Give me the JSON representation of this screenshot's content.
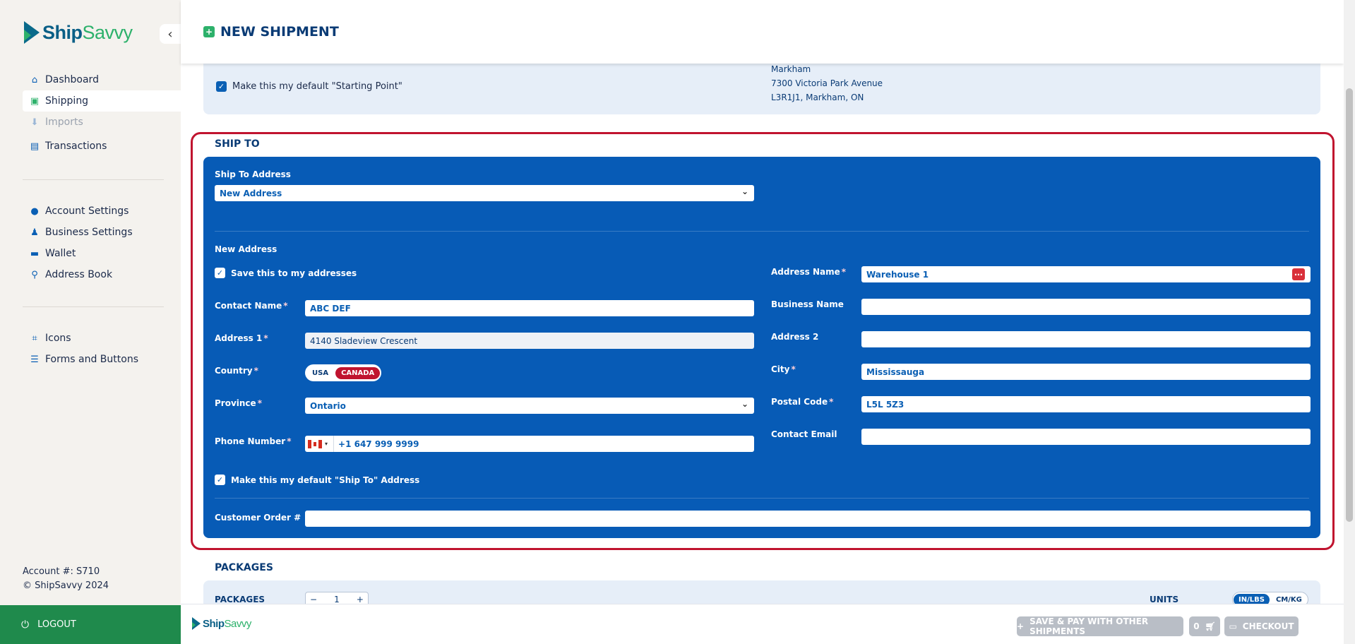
{
  "brand": {
    "name_part1": "Ship",
    "name_part2": "Savvy"
  },
  "sidebar": {
    "collapse_icon": "chevron-left-icon",
    "items": [
      {
        "label": "Dashboard",
        "icon": "home-icon"
      },
      {
        "label": "Shipping",
        "icon": "package-icon",
        "active": true
      },
      {
        "label": "Imports",
        "icon": "import-icon",
        "disabled": true
      },
      {
        "label": "Transactions",
        "icon": "document-icon"
      },
      {
        "label": "Account Settings",
        "icon": "user-circle-icon"
      },
      {
        "label": "Business Settings",
        "icon": "business-user-icon"
      },
      {
        "label": "Wallet",
        "icon": "wallet-icon"
      },
      {
        "label": "Address Book",
        "icon": "map-pin-icon"
      },
      {
        "label": "Icons",
        "icon": "scan-icon"
      },
      {
        "label": "Forms and Buttons",
        "icon": "table-icon"
      }
    ],
    "account_number": "Account #: S710",
    "copyright": "© ShipSavvy 2024",
    "logout": "LOGOUT"
  },
  "header": {
    "title": "NEW SHIPMENT"
  },
  "starting_point": {
    "default_label": "Make this my default \"Starting Point\"",
    "address_lines": [
      "Markham",
      "7300 Victoria Park Avenue",
      "L3R1J1, Markham, ON"
    ]
  },
  "ship_to": {
    "section_title": "SHIP TO",
    "address_select_label": "Ship To Address",
    "address_select_value": "New Address",
    "new_address_heading": "New Address",
    "save_label": "Save this to my addresses",
    "contact_name_label": "Contact Name",
    "contact_name_value": "ABC DEF",
    "address1_label": "Address 1",
    "address1_value": "4140 Sladeview Crescent",
    "country_label": "Country",
    "country_options": [
      "USA",
      "CANADA"
    ],
    "country_selected": "CANADA",
    "province_label": "Province",
    "province_value": "Ontario",
    "phone_label": "Phone Number",
    "phone_value": "+1 647 999 9999",
    "address_name_label": "Address Name",
    "address_name_value": "Warehouse 1",
    "business_name_label": "Business Name",
    "business_name_value": "",
    "address2_label": "Address 2",
    "address2_value": "",
    "city_label": "City",
    "city_value": "Mississauga",
    "postal_label": "Postal Code",
    "postal_value": "L5L 5Z3",
    "email_label": "Contact Email",
    "email_value": "",
    "default_label": "Make this my default \"Ship To\" Address",
    "customer_order_label": "Customer Order #",
    "customer_order_value": ""
  },
  "packages": {
    "section_title": "PACKAGES",
    "row_label": "PACKAGES",
    "count": "1",
    "units_label": "UNITS",
    "units_options": [
      "IN/LBS",
      "CM/KG"
    ],
    "units_selected": "IN/LBS"
  },
  "footer": {
    "save_pay_label": "SAVE & PAY WITH OTHER SHIPMENTS",
    "cart_count": "0",
    "checkout_label": "CHECKOUT"
  },
  "colors": {
    "primary": "#075bb6",
    "accent_green": "#2db16b",
    "highlight_red": "#c0142f",
    "navy": "#0a3b75"
  }
}
